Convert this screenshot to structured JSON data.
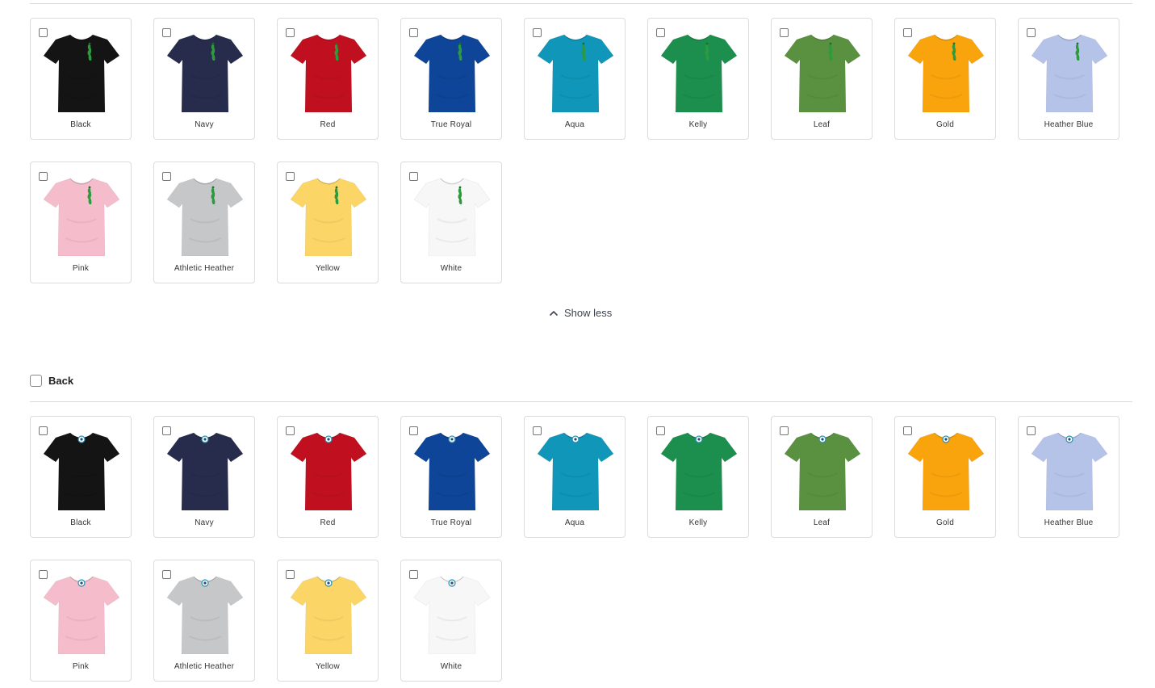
{
  "front": {
    "colors": [
      {
        "name": "Black",
        "hex": "#141414"
      },
      {
        "name": "Navy",
        "hex": "#272c4d"
      },
      {
        "name": "Red",
        "hex": "#c0101f"
      },
      {
        "name": "True Royal",
        "hex": "#0e4598"
      },
      {
        "name": "Aqua",
        "hex": "#0f96b8"
      },
      {
        "name": "Kelly",
        "hex": "#1c8f4f"
      },
      {
        "name": "Leaf",
        "hex": "#5a9140"
      },
      {
        "name": "Gold",
        "hex": "#f9a40c"
      },
      {
        "name": "Heather Blue",
        "hex": "#b6c3e8"
      },
      {
        "name": "Pink",
        "hex": "#f5bccb"
      },
      {
        "name": "Athletic Heather",
        "hex": "#c6c7c9"
      },
      {
        "name": "Yellow",
        "hex": "#fbd667"
      },
      {
        "name": "White",
        "hex": "#f7f7f7"
      }
    ],
    "design_icon": "green-figure-icon"
  },
  "toggle": {
    "show_less_label": "Show less",
    "icon": "chevron-up-icon"
  },
  "back": {
    "section_label": "Back",
    "colors": [
      {
        "name": "Black",
        "hex": "#141414"
      },
      {
        "name": "Navy",
        "hex": "#272c4d"
      },
      {
        "name": "Red",
        "hex": "#c0101f"
      },
      {
        "name": "True Royal",
        "hex": "#0e4598"
      },
      {
        "name": "Aqua",
        "hex": "#0f96b8"
      },
      {
        "name": "Kelly",
        "hex": "#1c8f4f"
      },
      {
        "name": "Leaf",
        "hex": "#5a9140"
      },
      {
        "name": "Gold",
        "hex": "#f9a40c"
      },
      {
        "name": "Heather Blue",
        "hex": "#b6c3e8"
      },
      {
        "name": "Pink",
        "hex": "#f5bccb"
      },
      {
        "name": "Athletic Heather",
        "hex": "#c6c7c9"
      },
      {
        "name": "Yellow",
        "hex": "#fbd667"
      },
      {
        "name": "White",
        "hex": "#f7f7f7"
      }
    ],
    "design_icon": "round-logo-icon"
  }
}
